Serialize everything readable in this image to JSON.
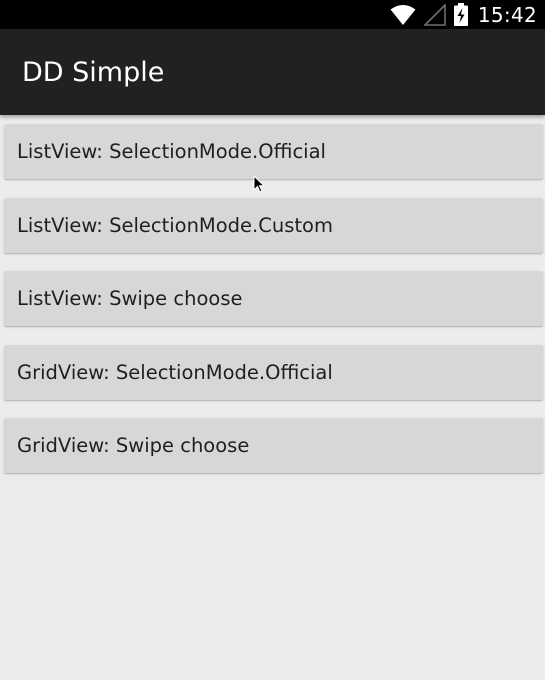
{
  "status_bar": {
    "time": "15:42",
    "icons": [
      "wifi-icon",
      "cell-signal-icon",
      "battery-charging-icon"
    ]
  },
  "app_bar": {
    "title": "DD Simple"
  },
  "menu": {
    "items": [
      {
        "label": "ListView: SelectionMode.Official"
      },
      {
        "label": "ListView: SelectionMode.Custom"
      },
      {
        "label": "ListView: Swipe choose"
      },
      {
        "label": "GridView: SelectionMode.Official"
      },
      {
        "label": "GridView: Swipe choose"
      }
    ]
  },
  "colors": {
    "status_bar_bg": "#000000",
    "app_bar_bg": "#212121",
    "page_bg": "#ececec",
    "button_bg": "#d6d7d7",
    "button_text": "#1f1f1f"
  }
}
